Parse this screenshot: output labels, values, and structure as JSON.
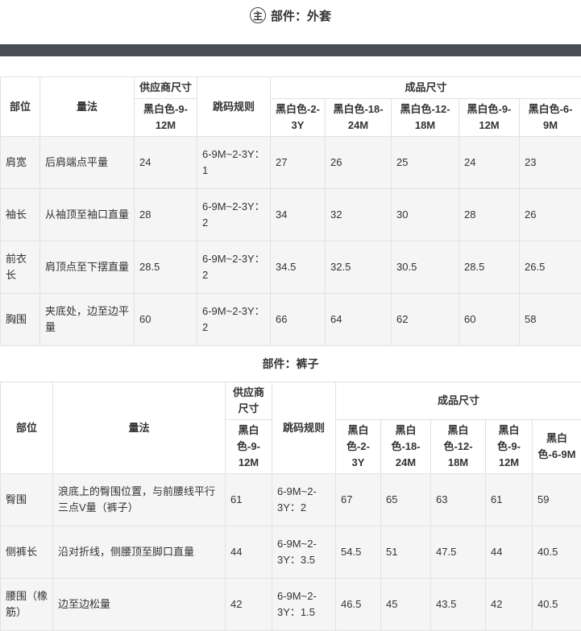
{
  "part1": {
    "badge": "主",
    "title": "部件：外套",
    "headers": {
      "part": "部位",
      "method": "量法",
      "supplier": "供应商尺寸",
      "supplier_size": "黑白色-9-12M",
      "jump": "跳码规则",
      "finished": "成品尺寸",
      "sizes": [
        "黑白色-2-3Y",
        "黑白色-18-24M",
        "黑白色-12-18M",
        "黑白色-9-12M",
        "黑白色-6-9M"
      ]
    },
    "rows": [
      {
        "part": "肩宽",
        "method": "后肩端点平量",
        "supplier": "24",
        "jump": "6-9M~2-3Y：1",
        "values": [
          "27",
          "26",
          "25",
          "24",
          "23"
        ]
      },
      {
        "part": "袖长",
        "method": "从袖顶至袖口直量",
        "supplier": "28",
        "jump": "6-9M~2-3Y：2",
        "values": [
          "34",
          "32",
          "30",
          "28",
          "26"
        ]
      },
      {
        "part": "前衣长",
        "method": "肩顶点至下摆直量",
        "supplier": "28.5",
        "jump": "6-9M~2-3Y：2",
        "values": [
          "34.5",
          "32.5",
          "30.5",
          "28.5",
          "26.5"
        ]
      },
      {
        "part": "胸围",
        "method": "夹底处，边至边平量",
        "supplier": "60",
        "jump": "6-9M~2-3Y：2",
        "values": [
          "66",
          "64",
          "62",
          "60",
          "58"
        ]
      }
    ]
  },
  "part2": {
    "title": "部件：裤子",
    "headers": {
      "part": "部位",
      "method": "量法",
      "supplier": "供应商尺寸",
      "supplier_size": "黑白色-9-12M",
      "jump": "跳码规则",
      "finished": "成品尺寸",
      "sizes": [
        "黑白色-2-3Y",
        "黑白色-18-24M",
        "黑白色-12-18M",
        "黑白色-9-12M",
        "黑白色-6-9M"
      ]
    },
    "rows": [
      {
        "part": "臀围",
        "method": "浪底上的臀围位置，与前腰线平行三点V量（裤子）",
        "supplier": "61",
        "jump": "6-9M~2-3Y：2",
        "values": [
          "67",
          "65",
          "63",
          "61",
          "59"
        ]
      },
      {
        "part": "侧裤长",
        "method": "沿对折线，侧腰顶至脚口直量",
        "supplier": "44",
        "jump": "6-9M~2-3Y：3.5",
        "values": [
          "54.5",
          "51",
          "47.5",
          "44",
          "40.5"
        ]
      },
      {
        "part": "腰围（橡筋）",
        "method": "边至边松量",
        "supplier": "42",
        "jump": "6-9M~2-3Y：1.5",
        "values": [
          "46.5",
          "45",
          "43.5",
          "42",
          "40.5"
        ]
      }
    ]
  }
}
